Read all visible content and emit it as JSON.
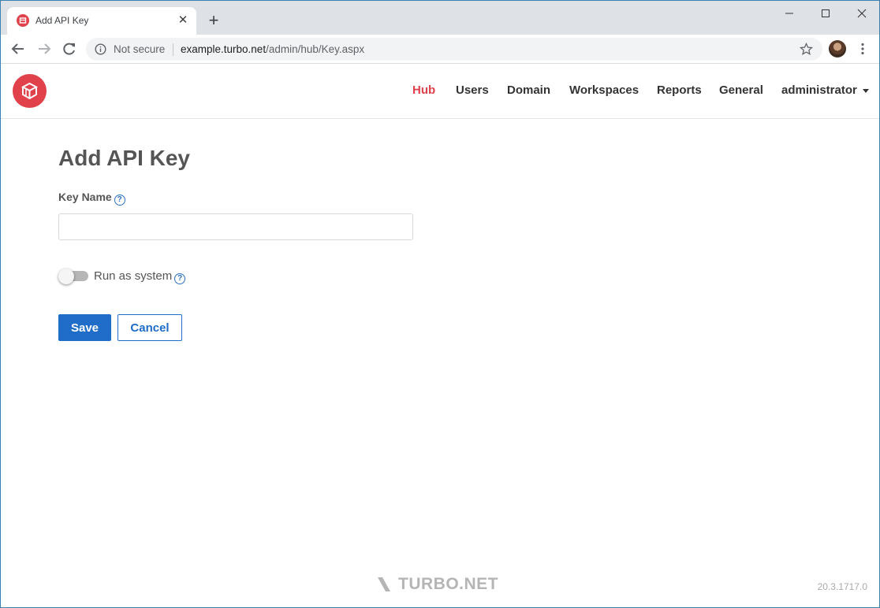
{
  "browser": {
    "tab_title": "Add API Key",
    "security_label": "Not secure",
    "url_host": "example.turbo.net",
    "url_path": "/admin/hub/Key.aspx"
  },
  "nav": {
    "items": [
      {
        "label": "Hub",
        "active": true
      },
      {
        "label": "Users",
        "active": false
      },
      {
        "label": "Domain",
        "active": false
      },
      {
        "label": "Workspaces",
        "active": false
      },
      {
        "label": "Reports",
        "active": false
      },
      {
        "label": "General",
        "active": false
      }
    ],
    "user_menu_label": "administrator"
  },
  "form": {
    "title": "Add API Key",
    "key_name_label": "Key Name",
    "key_name_value": "",
    "key_name_placeholder": "",
    "run_as_system_label": "Run as system",
    "run_as_system_on": false,
    "save_label": "Save",
    "cancel_label": "Cancel"
  },
  "footer": {
    "brand": "TURBO.NET",
    "version": "20.3.1717.0"
  },
  "colors": {
    "brand_red": "#e0414a",
    "primary_blue": "#1f6dc8"
  }
}
